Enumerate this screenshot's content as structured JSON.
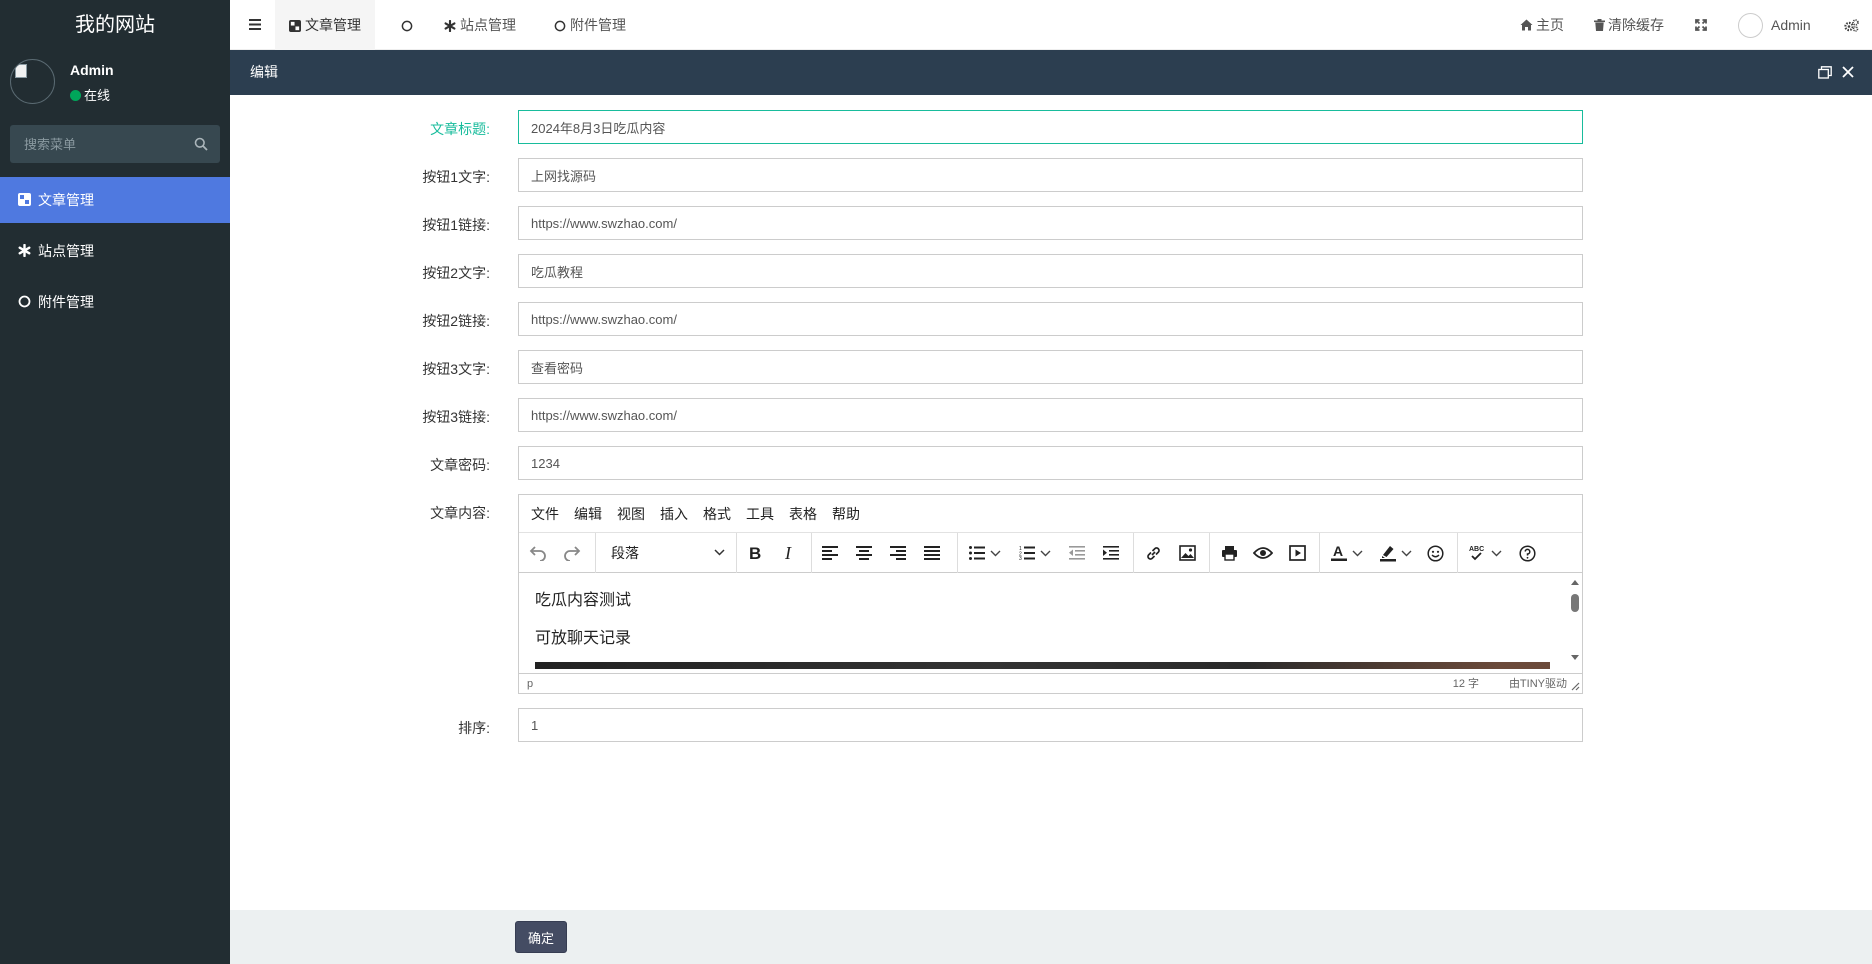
{
  "sidebar": {
    "logo": "我的网站",
    "user": {
      "name": "Admin",
      "status": "在线"
    },
    "search": {
      "placeholder": "搜索菜单"
    },
    "items": [
      {
        "label": "文章管理",
        "icon": "dashboard-icon",
        "active": true
      },
      {
        "label": "站点管理",
        "icon": "asterisk-icon",
        "active": false
      },
      {
        "label": "附件管理",
        "icon": "circle-icon",
        "active": false
      }
    ]
  },
  "navbar": {
    "tabs": [
      {
        "label": "文章管理",
        "icon": "dashboard-icon"
      },
      {
        "label": "",
        "icon": "circle-icon"
      },
      {
        "label": "站点管理",
        "icon": "asterisk-icon"
      },
      {
        "label": "附件管理",
        "icon": "circle-icon"
      }
    ],
    "home_label": "主页",
    "clear_cache_label": "清除缓存",
    "user_label": "Admin"
  },
  "dialog": {
    "title": "编辑"
  },
  "form": {
    "fields": [
      {
        "label": "文章标题:",
        "value": "2024年8月3日吃瓜内容"
      },
      {
        "label": "按钮1文字:",
        "value": "上网找源码"
      },
      {
        "label": "按钮1链接:",
        "value": "https://www.swzhao.com/"
      },
      {
        "label": "按钮2文字:",
        "value": "吃瓜教程"
      },
      {
        "label": "按钮2链接:",
        "value": "https://www.swzhao.com/"
      },
      {
        "label": "按钮3文字:",
        "value": "查看密码"
      },
      {
        "label": "按钮3链接:",
        "value": "https://www.swzhao.com/"
      },
      {
        "label": "文章密码:",
        "value": "1234"
      }
    ],
    "content_label": "文章内容:",
    "sort_label": "排序:",
    "sort_value": "1"
  },
  "editor": {
    "menubar": [
      "文件",
      "编辑",
      "视图",
      "插入",
      "格式",
      "工具",
      "表格",
      "帮助"
    ],
    "block_format": "段落",
    "content": [
      "吃瓜内容测试",
      "可放聊天记录"
    ],
    "status_path": "p",
    "word_count": "12 字",
    "powered_by": "由TINY驱动"
  },
  "footer": {
    "confirm_label": "确定"
  },
  "colors": {
    "sidebar_bg": "#222d32",
    "active_menu": "#4f79e0",
    "dialog_bar": "#2c3e50",
    "focus": "#18bc9c",
    "confirm_btn": "#444c63"
  }
}
